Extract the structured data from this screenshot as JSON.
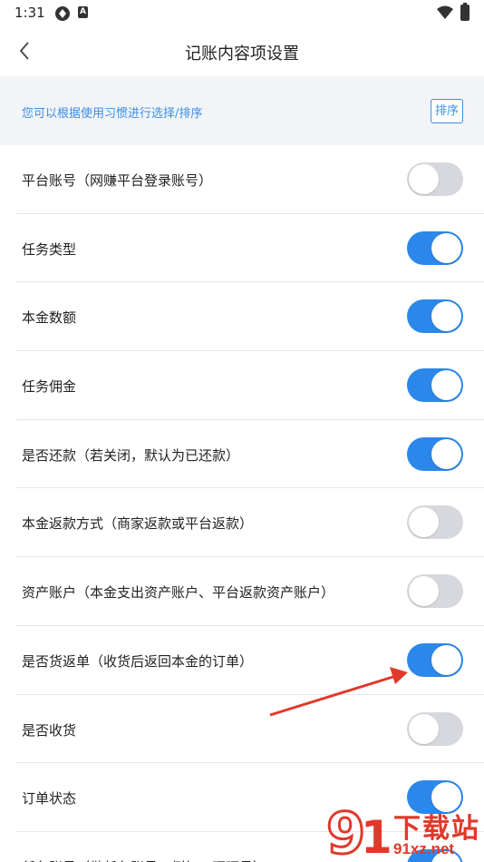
{
  "status_bar": {
    "time": "1:31",
    "icon_b": "A"
  },
  "header": {
    "title": "记账内容项设置"
  },
  "info": {
    "text": "您可以根据使用习惯进行选择/排序",
    "sort_label": "排序"
  },
  "settings": [
    {
      "label": "平台账号（网赚平台登录账号）",
      "enabled": false
    },
    {
      "label": "任务类型",
      "enabled": true
    },
    {
      "label": "本金数额",
      "enabled": true
    },
    {
      "label": "任务佣金",
      "enabled": true
    },
    {
      "label": "是否还款（若关闭，默认为已还款）",
      "enabled": true
    },
    {
      "label": "本金返款方式（商家返款或平台返款）",
      "enabled": false
    },
    {
      "label": "资产账户（本金支出资产账户、平台返款资产账户）",
      "enabled": false
    },
    {
      "label": "是否货返单（收货后返回本金的订单）",
      "enabled": true
    },
    {
      "label": "是否收货",
      "enabled": false
    },
    {
      "label": "订单状态",
      "enabled": true
    },
    {
      "label": "任务账号（做任务账号，例如：旺旺号）",
      "enabled": true
    }
  ],
  "watermark": {
    "title": "下载站",
    "site": "91xz.net"
  },
  "colors": {
    "accent": "#2b88ea",
    "switch_off": "#d7d8dd",
    "annotation": "#e0392b"
  }
}
